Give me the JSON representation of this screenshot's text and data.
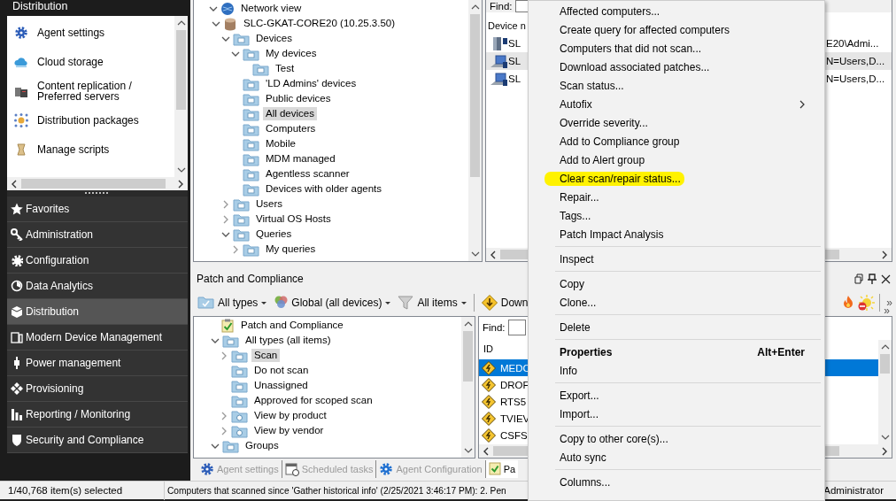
{
  "sidebar": {
    "header": "Distribution",
    "tools": [
      {
        "label": "Agent settings"
      },
      {
        "label": "Cloud storage"
      },
      {
        "label": "Content replication / Preferred servers"
      },
      {
        "label": "Distribution packages"
      },
      {
        "label": "Manage scripts"
      }
    ],
    "nav": [
      {
        "label": "Favorites",
        "selected": false
      },
      {
        "label": "Administration",
        "selected": false
      },
      {
        "label": "Configuration",
        "selected": false
      },
      {
        "label": "Data Analytics",
        "selected": false
      },
      {
        "label": "Distribution",
        "selected": true
      },
      {
        "label": "Modern Device Management",
        "selected": false
      },
      {
        "label": "Power management",
        "selected": false
      },
      {
        "label": "Provisioning",
        "selected": false
      },
      {
        "label": "Reporting / Monitoring",
        "selected": false
      },
      {
        "label": "Security and Compliance",
        "selected": false
      }
    ]
  },
  "device_tree": {
    "items": [
      {
        "label": "Network view",
        "kind": "network",
        "expanded": true,
        "selected": false,
        "children": [
          {
            "label": "SLC-GKAT-CORE20 (10.25.3.50)",
            "kind": "server",
            "expanded": true,
            "selected": false,
            "children": [
              {
                "label": "Devices",
                "kind": "folder",
                "expanded": true,
                "selected": false,
                "children": [
                  {
                    "label": "My devices",
                    "kind": "folder",
                    "expanded": true,
                    "selected": false,
                    "children": [
                      {
                        "label": "Test",
                        "kind": "folder",
                        "selected": false
                      }
                    ]
                  },
                  {
                    "label": "'LD Admins' devices",
                    "kind": "folder",
                    "selected": false
                  },
                  {
                    "label": "Public devices",
                    "kind": "folder",
                    "selected": false
                  },
                  {
                    "label": "All devices",
                    "kind": "folder",
                    "selected": true
                  },
                  {
                    "label": "Computers",
                    "kind": "folder",
                    "selected": false
                  },
                  {
                    "label": "Mobile",
                    "kind": "folder",
                    "selected": false
                  },
                  {
                    "label": "MDM managed",
                    "kind": "folder",
                    "selected": false
                  },
                  {
                    "label": "Agentless scanner",
                    "kind": "folder",
                    "selected": false
                  },
                  {
                    "label": "Devices with older agents",
                    "kind": "folder",
                    "selected": false
                  }
                ]
              },
              {
                "label": "Users",
                "kind": "folder",
                "expanded": false,
                "selected": false
              },
              {
                "label": "Virtual OS Hosts",
                "kind": "folder",
                "expanded": false,
                "selected": false
              },
              {
                "label": "Queries",
                "kind": "folder",
                "expanded": true,
                "selected": false,
                "children": [
                  {
                    "label": "My queries",
                    "kind": "folder",
                    "expanded": false,
                    "selected": false
                  }
                ]
              }
            ]
          }
        ]
      }
    ]
  },
  "device_list": {
    "find_label": "Find:",
    "column_1": "Device n",
    "rows": [
      {
        "name": "SL",
        "kind": "server",
        "column_2": "E20\\Admi...",
        "selected": false
      },
      {
        "name": "SL",
        "kind": "laptop",
        "column_2": "N=Users,D...",
        "selected": true
      },
      {
        "name": "SL",
        "kind": "laptop",
        "column_2": "N=Users,D...",
        "selected": false
      }
    ]
  },
  "patch_panel": {
    "title": "Patch and Compliance",
    "toolbar": [
      {
        "label": "All types",
        "dropdown": true
      },
      {
        "label": "Global (all devices)",
        "dropdown": true
      },
      {
        "label": "All items",
        "dropdown": true
      },
      {
        "label": "Down",
        "dropdown": false
      }
    ],
    "toolbar_overflow": "»",
    "panel_overflow": "»",
    "tree": [
      {
        "label": "Patch and Compliance",
        "kind": "compliance",
        "selected": false,
        "children": [
          {
            "label": "All types (all items)",
            "kind": "folder",
            "expanded": true,
            "selected": false,
            "children": [
              {
                "label": "Scan",
                "kind": "folder",
                "expanded": false,
                "selected": true
              },
              {
                "label": "Do not scan",
                "kind": "folder",
                "selected": false
              },
              {
                "label": "Unassigned",
                "kind": "folder",
                "selected": false
              },
              {
                "label": "Approved for scoped scan",
                "kind": "folder",
                "selected": false
              },
              {
                "label": "View by product",
                "kind": "view",
                "expanded": false,
                "selected": false
              },
              {
                "label": "View by vendor",
                "kind": "view",
                "expanded": false,
                "selected": false
              }
            ]
          },
          {
            "label": "Groups",
            "kind": "folder",
            "expanded": true,
            "selected": false
          }
        ]
      }
    ],
    "list": {
      "find_label": "Find:",
      "column_1": "ID",
      "rows": [
        {
          "id": "MEDC",
          "selected": true
        },
        {
          "id": "DROF",
          "selected": false
        },
        {
          "id": "RTS5",
          "selected": false
        },
        {
          "id": "TVIEV",
          "selected": false
        },
        {
          "id": "CSFS",
          "selected": false
        }
      ]
    }
  },
  "tabs": [
    {
      "label": "Agent settings",
      "selected": false
    },
    {
      "label": "Scheduled tasks",
      "selected": false
    },
    {
      "label": "Agent Configuration",
      "selected": false
    },
    {
      "label": "Pa",
      "selected": true
    }
  ],
  "status_bar": {
    "selection": "1/40,768 item(s) selected",
    "message": "Computers that scanned since 'Gather historical info' (2/25/2021 3:46:17 PM): 2.  Pen",
    "user": "Administrator"
  },
  "context_menu": {
    "groups": [
      [
        {
          "label": "Affected computers...",
          "default": false,
          "submenu": false,
          "highlighted": false
        },
        {
          "label": "Create query for affected computers",
          "default": false,
          "submenu": false,
          "highlighted": false
        },
        {
          "label": "Computers that did not scan...",
          "default": false,
          "submenu": false,
          "highlighted": false
        },
        {
          "label": "Download associated patches...",
          "default": false,
          "submenu": false,
          "highlighted": false
        },
        {
          "label": "Scan status...",
          "default": false,
          "submenu": false,
          "highlighted": false
        },
        {
          "label": "Autofix",
          "default": false,
          "submenu": true,
          "highlighted": false
        },
        {
          "label": "Override severity...",
          "default": false,
          "submenu": false,
          "highlighted": false
        },
        {
          "label": "Add to Compliance group",
          "default": false,
          "submenu": false,
          "highlighted": false
        },
        {
          "label": "Add to Alert group",
          "default": false,
          "submenu": false,
          "highlighted": false
        },
        {
          "label": "Clear scan/repair status...",
          "default": false,
          "submenu": false,
          "highlighted": true
        },
        {
          "label": "Repair...",
          "default": false,
          "submenu": false,
          "highlighted": false
        },
        {
          "label": "Tags...",
          "default": false,
          "submenu": false,
          "highlighted": false
        },
        {
          "label": "Patch Impact Analysis",
          "default": false,
          "submenu": false,
          "highlighted": false
        }
      ],
      [
        {
          "label": "Inspect",
          "default": false,
          "submenu": false,
          "highlighted": false
        }
      ],
      [
        {
          "label": "Copy",
          "default": false,
          "submenu": false,
          "highlighted": false
        },
        {
          "label": "Clone...",
          "default": false,
          "submenu": false,
          "highlighted": false
        }
      ],
      [
        {
          "label": "Delete",
          "default": false,
          "submenu": false,
          "highlighted": false
        }
      ],
      [
        {
          "label": "Properties",
          "shortcut": "Alt+Enter",
          "default": true,
          "submenu": false,
          "highlighted": false
        },
        {
          "label": "Info",
          "default": false,
          "submenu": false,
          "highlighted": false
        }
      ],
      [
        {
          "label": "Export...",
          "default": false,
          "submenu": false,
          "highlighted": false
        },
        {
          "label": "Import...",
          "default": false,
          "submenu": false,
          "highlighted": false
        }
      ],
      [
        {
          "label": "Copy to other core(s)...",
          "default": false,
          "submenu": false,
          "highlighted": false
        },
        {
          "label": "Auto sync",
          "default": false,
          "submenu": false,
          "highlighted": false
        }
      ],
      [
        {
          "label": "Columns...",
          "default": false,
          "submenu": false,
          "highlighted": false
        }
      ]
    ]
  }
}
